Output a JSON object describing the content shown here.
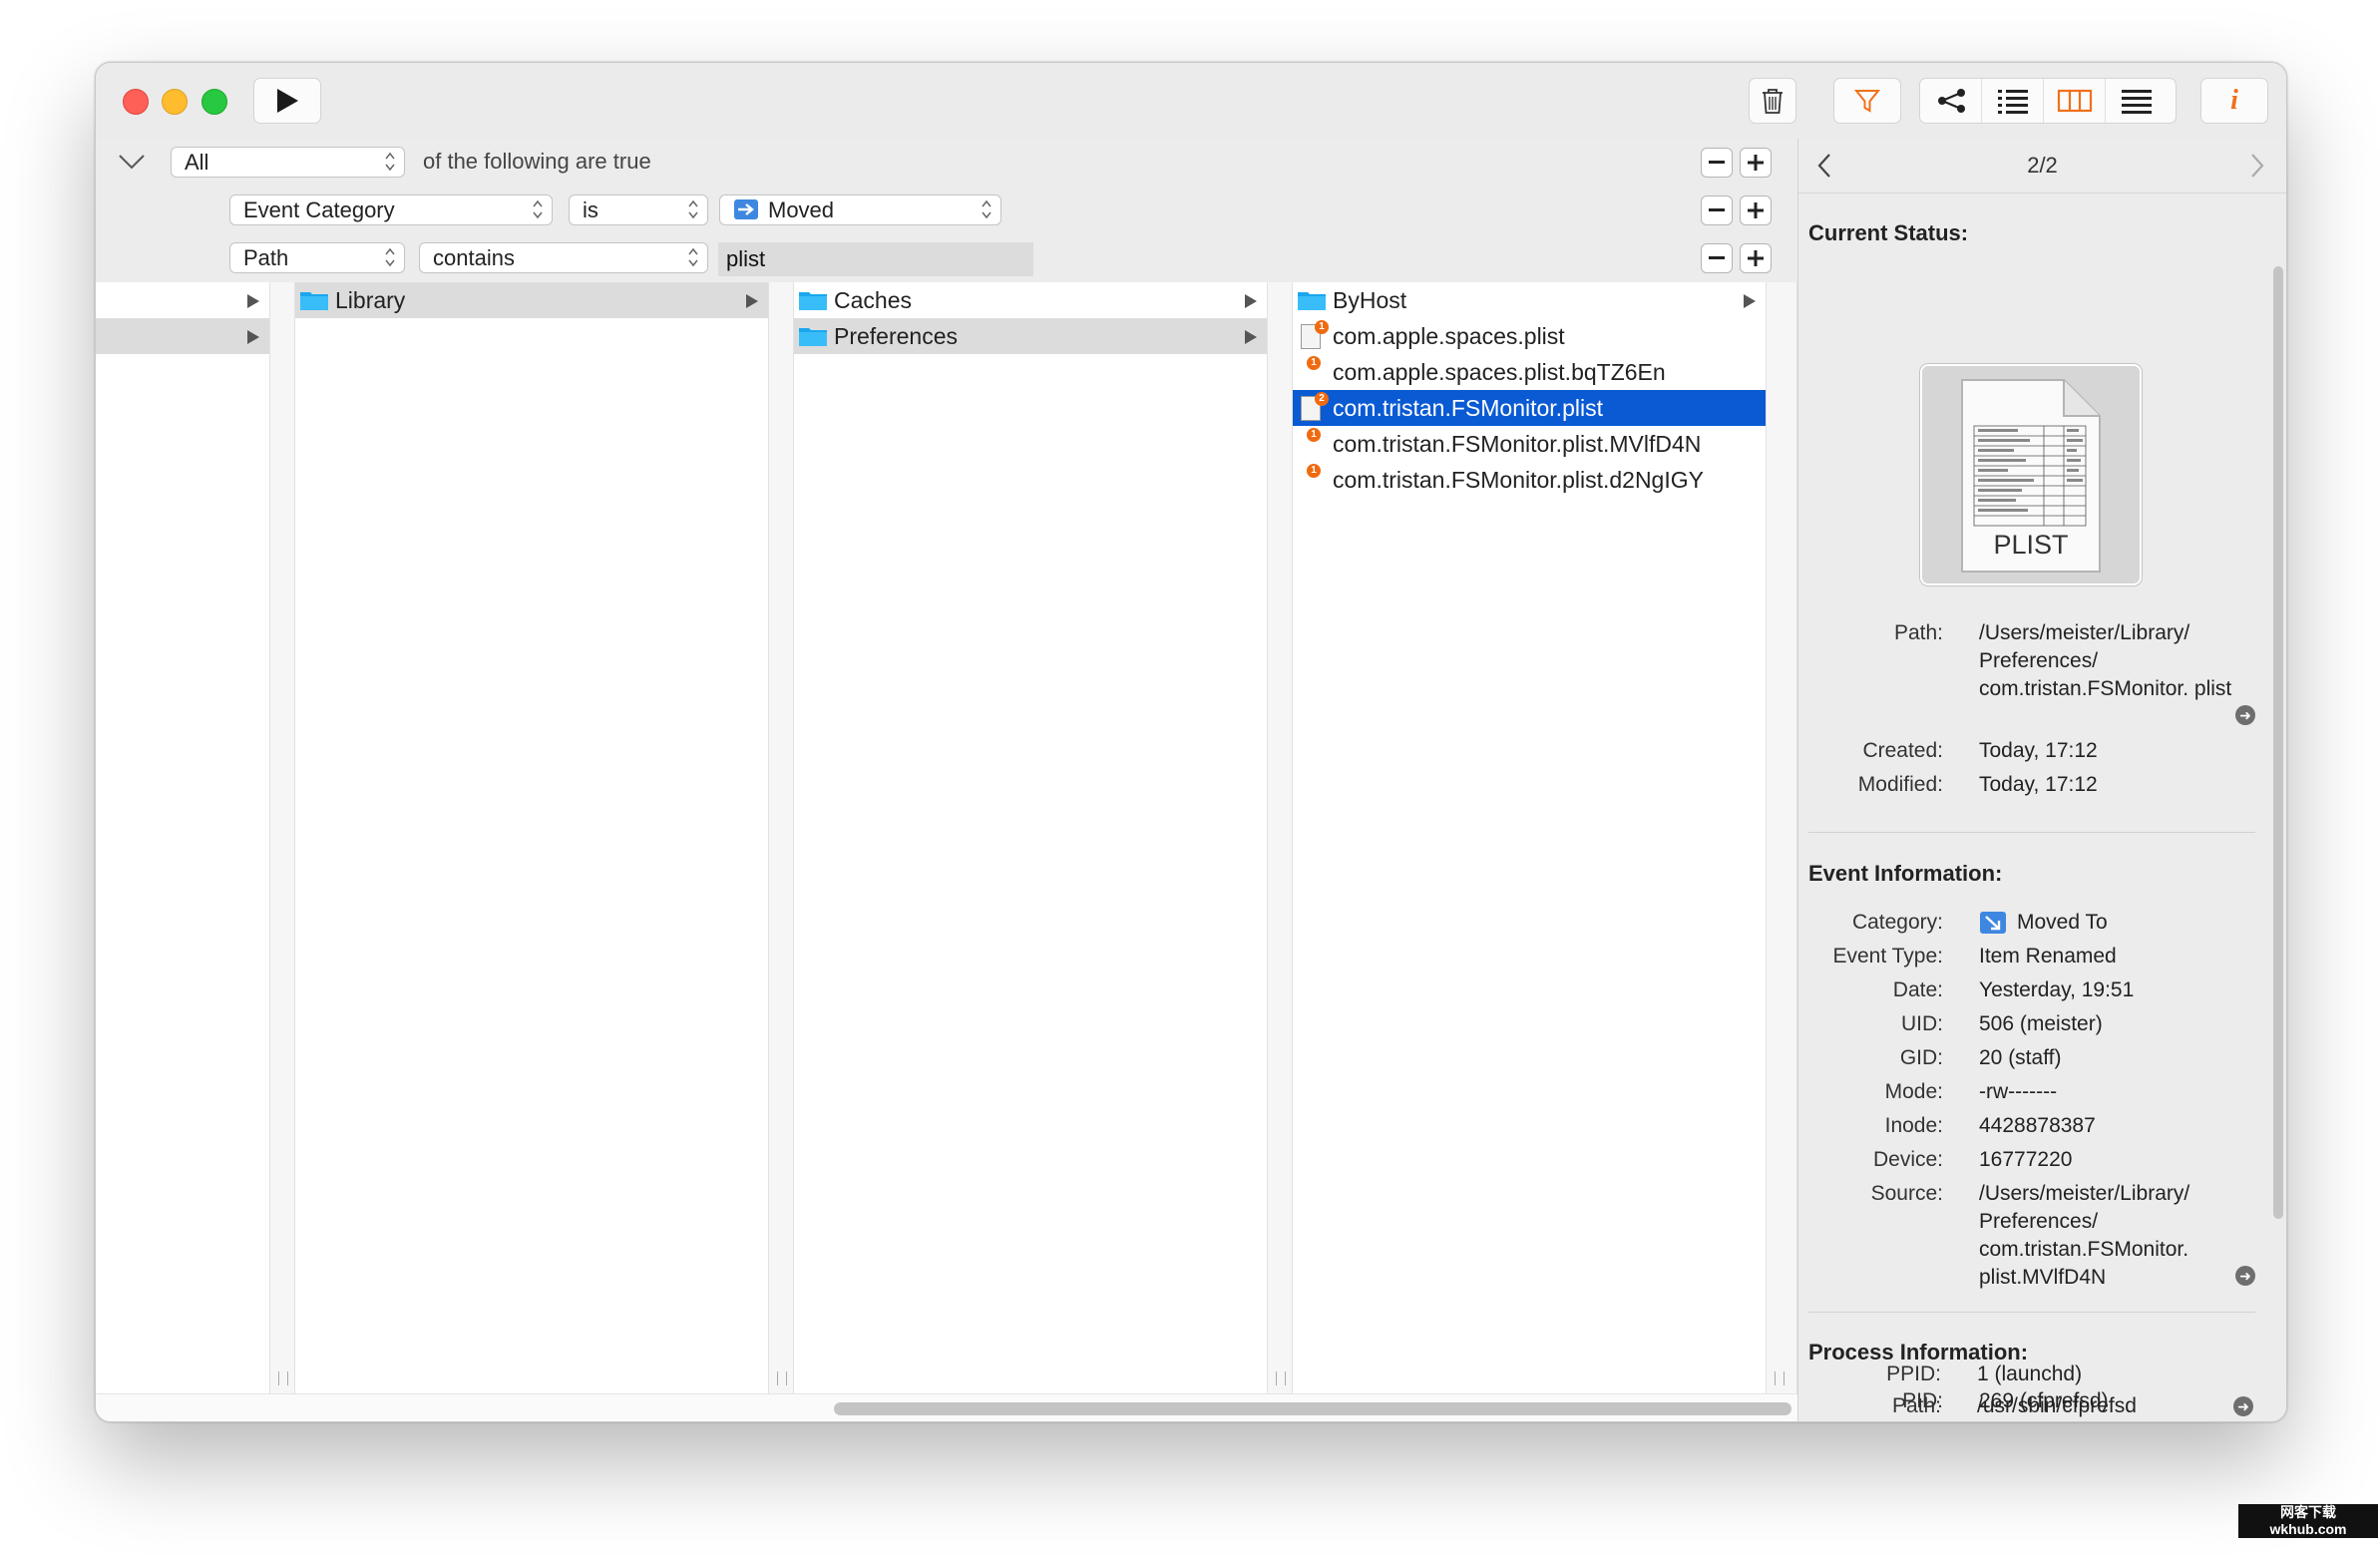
{
  "filter": {
    "match_mode": "All",
    "match_suffix": "of the following are true",
    "rules": [
      {
        "field": "Event Category",
        "operator": "is",
        "value": "Moved"
      },
      {
        "field": "Path",
        "operator": "contains",
        "value": "plist"
      }
    ]
  },
  "browser": {
    "col1": [
      {
        "name": "Library"
      }
    ],
    "col2": [
      {
        "name": "Caches"
      },
      {
        "name": "Preferences"
      }
    ],
    "col3": [
      {
        "name": "ByHost",
        "kind": "folder"
      },
      {
        "name": "com.apple.spaces.plist",
        "badge": "1"
      },
      {
        "name": "com.apple.spaces.plist.bqTZ6En",
        "badge": "1"
      },
      {
        "name": "com.tristan.FSMonitor.plist",
        "badge": "2",
        "selected": true
      },
      {
        "name": "com.tristan.FSMonitor.plist.MVlfD4N",
        "badge": "1"
      },
      {
        "name": "com.tristan.FSMonitor.plist.d2NgIGY",
        "badge": "1"
      }
    ]
  },
  "inspector": {
    "page": "2/2",
    "current_status_title": "Current Status:",
    "preview_label": "PLIST",
    "status": {
      "path_label": "Path:",
      "path_value": "/Users/meister/Library/ Preferences/ com.tristan.FSMonitor. plist",
      "created_label": "Created:",
      "created_value": "Today, 17:12",
      "modified_label": "Modified:",
      "modified_value": "Today, 17:12"
    },
    "event_title": "Event Information:",
    "event": {
      "category_label": "Category:",
      "category_value": "Moved To",
      "type_label": "Event Type:",
      "type_value": "Item Renamed",
      "date_label": "Date:",
      "date_value": "Yesterday, 19:51",
      "uid_label": "UID:",
      "uid_value": "506 (meister)",
      "gid_label": "GID:",
      "gid_value": "20 (staff)",
      "mode_label": "Mode:",
      "mode_value": "-rw-------",
      "inode_label": "Inode:",
      "inode_value": "4428878387",
      "device_label": "Device:",
      "device_value": "16777220",
      "source_label": "Source:",
      "source_value": "/Users/meister/Library/ Preferences/ com.tristan.FSMonitor. plist.MVlfD4N"
    },
    "process_title": "Process Information:",
    "process": {
      "pid_label": "PID:",
      "pid_value": "269 (cfprefsd)",
      "ppid_label": "PPID:",
      "ppid_value": "1 (launchd)",
      "path_label": "Path:",
      "path_value": "/usr/sbin/cfprefsd"
    }
  },
  "watermark": {
    "line1": "网客下载",
    "line2": "wkhub.com"
  },
  "colors": {
    "selection": "#0a5ad4",
    "badge": "#f06a0f",
    "accent": "#f0701a",
    "folder": "#1aa7ee"
  }
}
